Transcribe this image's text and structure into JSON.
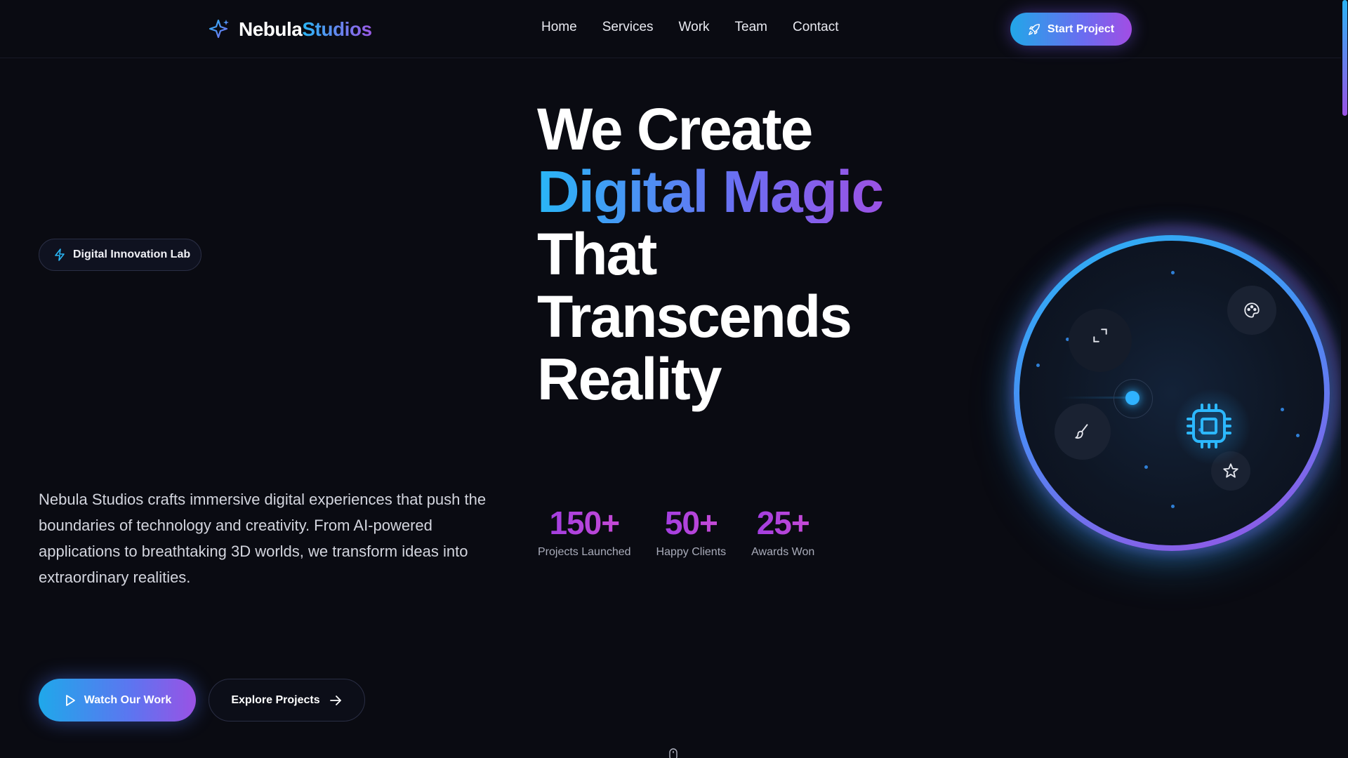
{
  "nav": {
    "logo_part1": "Nebula",
    "logo_part2": "Studios",
    "links": [
      "Home",
      "Services",
      "Work",
      "Team",
      "Contact"
    ],
    "cta_label": "Start Project"
  },
  "hero": {
    "badge": "Digital Innovation Lab",
    "headline_line1": "We Create",
    "headline_line2": "Digital Magic",
    "headline_line3": "That",
    "headline_line4": "Transcends",
    "headline_line5": "Reality",
    "description": "Nebula Studios crafts immersive digital experiences that push the boundaries of technology and creativity. From AI-powered applications to breathtaking 3D worlds, we transform ideas into extraordinary realities.",
    "primary_button": "Watch Our Work",
    "secondary_button": "Explore Projects"
  },
  "stats": [
    {
      "value": "150+",
      "label": "Projects Launched"
    },
    {
      "value": "50+",
      "label": "Happy Clients"
    },
    {
      "value": "25+",
      "label": "Awards Won"
    }
  ],
  "icons": {
    "logo": "sparkles-icon",
    "cta": "rocket-icon",
    "badge": "lightning-icon",
    "primary_button": "play-icon",
    "secondary_button": "arrow-right-icon",
    "orb_center": "cpu-chip-icon",
    "orb_float": [
      "expand-icon",
      "palette-icon",
      "brush-icon",
      "star-icon"
    ],
    "scroll": "mouse-icon"
  },
  "colors": {
    "background": "#0a0b12",
    "accent_blue": "#29b6f6",
    "accent_purple": "#a24de4"
  }
}
